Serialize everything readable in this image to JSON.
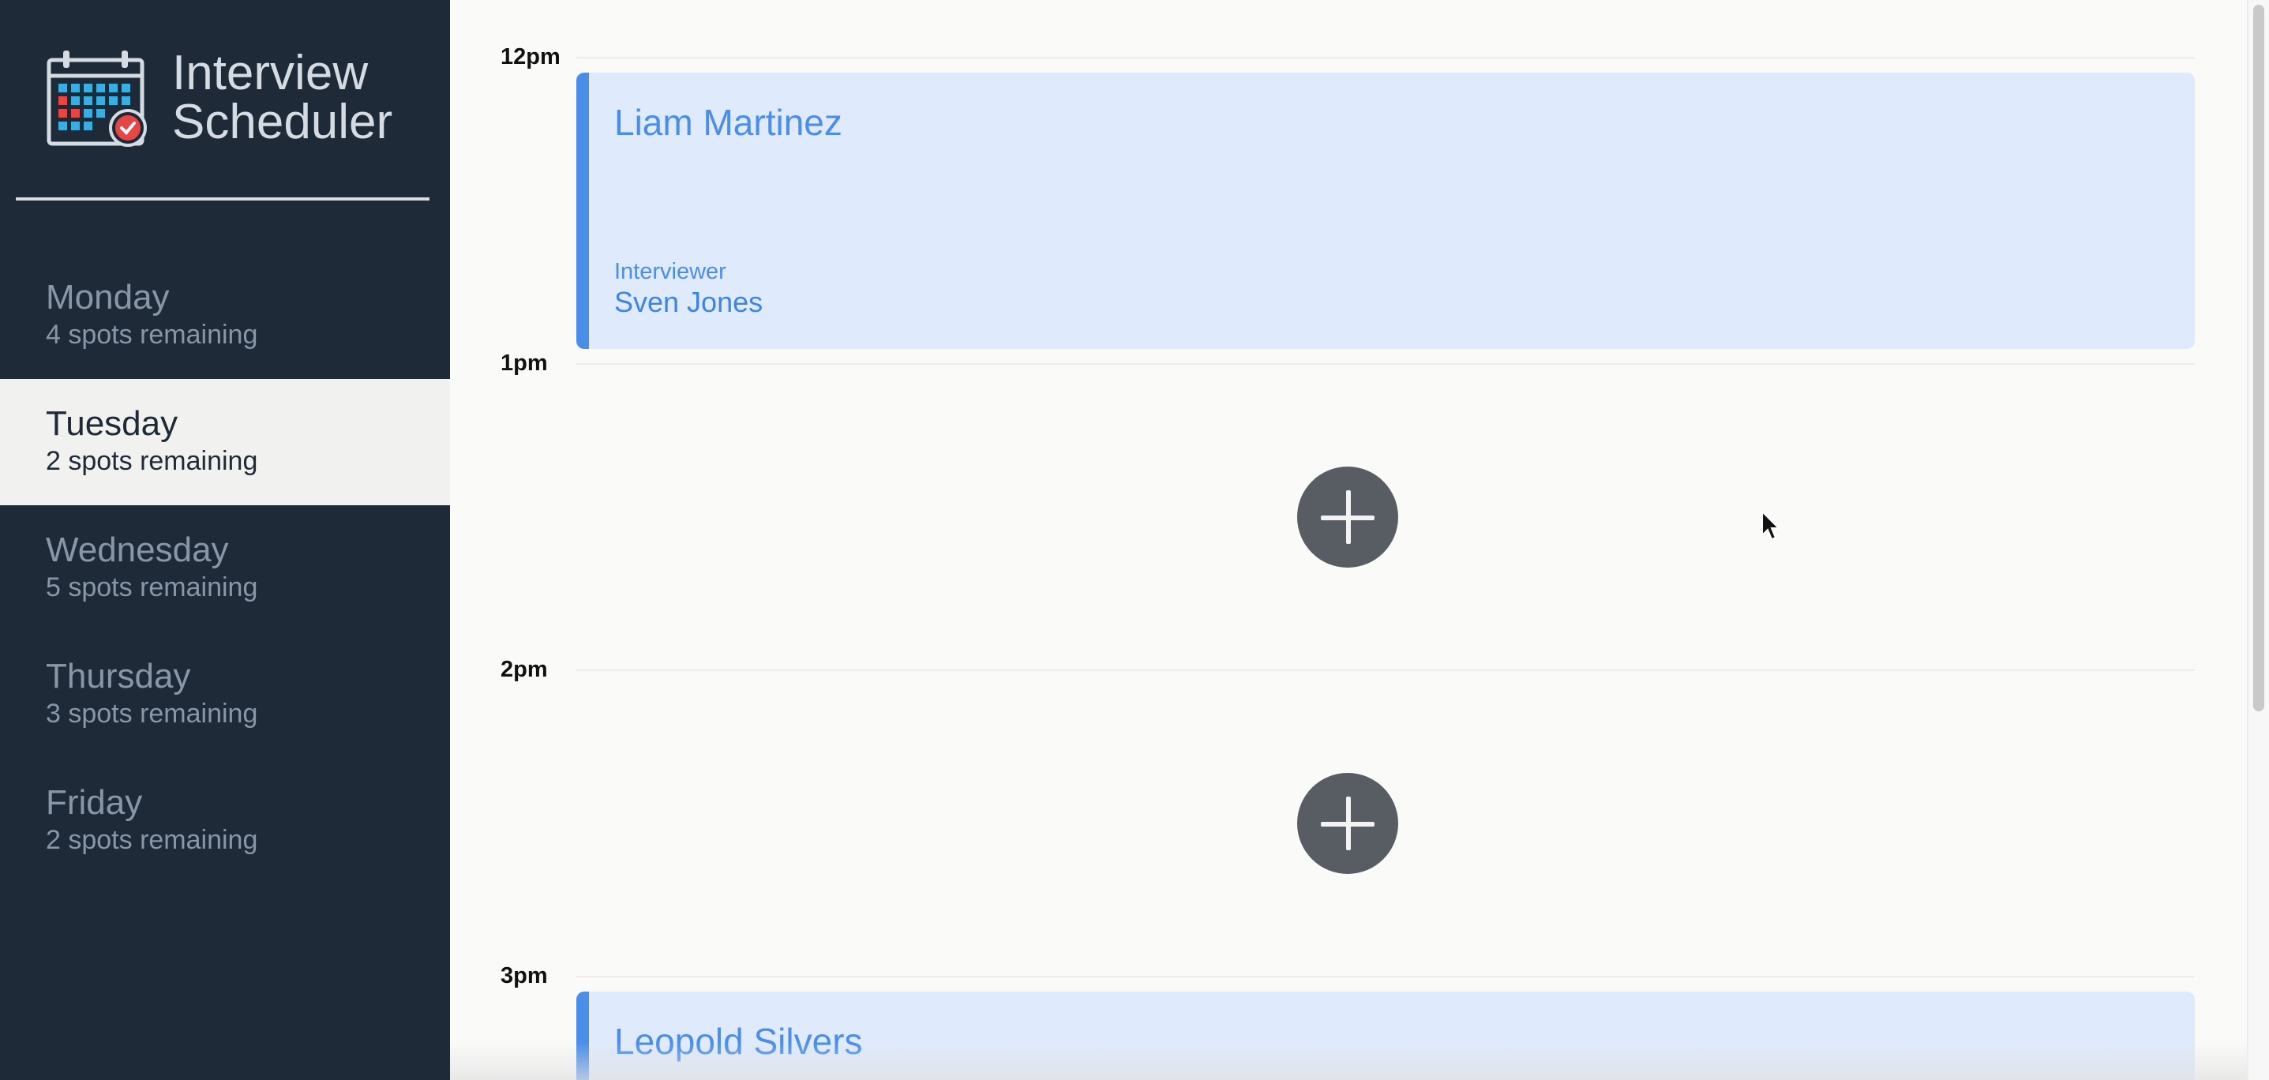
{
  "app": {
    "title_line1": "Interview",
    "title_line2": "Scheduler",
    "logo_icon": "calendar-check-icon"
  },
  "sidebar": {
    "days": [
      {
        "name": "Monday",
        "spots": "4 spots remaining",
        "selected": false
      },
      {
        "name": "Tuesday",
        "spots": "2 spots remaining",
        "selected": true
      },
      {
        "name": "Wednesday",
        "spots": "5 spots remaining",
        "selected": false
      },
      {
        "name": "Thursday",
        "spots": "3 spots remaining",
        "selected": false
      },
      {
        "name": "Friday",
        "spots": "2 spots remaining",
        "selected": false
      }
    ]
  },
  "schedule": {
    "hours": [
      "12pm",
      "1pm",
      "2pm",
      "3pm"
    ],
    "appointments": [
      {
        "student": "Liam Martinez",
        "interviewer_label": "Interviewer",
        "interviewer": "Sven Jones"
      },
      {
        "student": "Leopold Silvers"
      }
    ],
    "add_icon": "plus-icon"
  },
  "colors": {
    "sidebar_bg": "#1e2a37",
    "selected_day_bg": "#f1f1f0",
    "appointment_bg": "#dfeafc",
    "accent": "#4a8ee8",
    "add_button": "#585d63"
  }
}
